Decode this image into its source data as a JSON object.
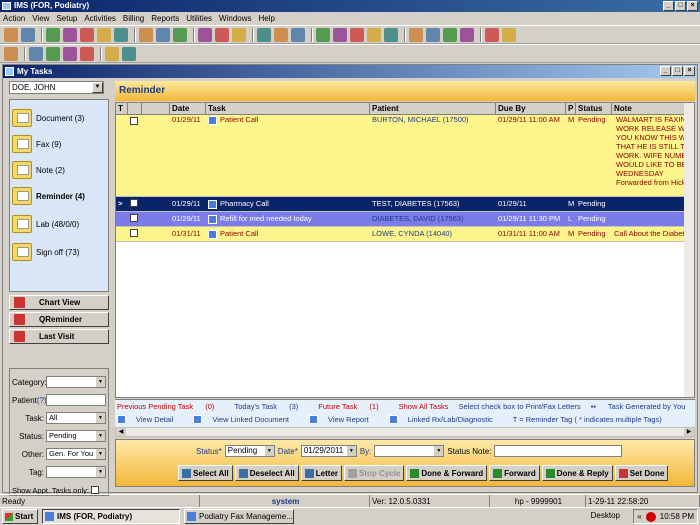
{
  "window": {
    "title": "IMS (FOR, Podiatry)",
    "controls": [
      "_",
      "□",
      "×"
    ]
  },
  "menu": [
    "Action",
    "View",
    "Setup",
    "Activities",
    "Billing",
    "Reports",
    "Utilities",
    "Windows",
    "Help"
  ],
  "toolbar_icons_row1": [
    "home-icon",
    "doctor-icon",
    "user-icon",
    "lab-icon",
    "document-icon",
    "chart-icon",
    "pdf-icon",
    "refresh-icon",
    "scan-icon",
    "calendar-icon",
    "sync-icon",
    "grid-icon",
    "tree-icon",
    "pen-icon",
    "mail-icon",
    "folder-icon",
    "export-icon",
    "import-icon",
    "person-icon",
    "gear-icon",
    "print-icon",
    "excel-icon",
    "word-icon",
    "note-icon",
    "help-icon",
    "lock-icon",
    "exit-icon"
  ],
  "toolbar_icons_row2": [
    "save-icon",
    "first-icon",
    "prev-icon",
    "next-icon",
    "last-icon",
    "reload-icon",
    "cancel-icon"
  ],
  "mdi": {
    "title": "My Tasks",
    "controls": [
      "_",
      "□",
      "×"
    ]
  },
  "patient_select": "DOE, JOHN",
  "categories": [
    {
      "label": "Document (3)"
    },
    {
      "label": "Fax (9)"
    },
    {
      "label": "Note (2)"
    },
    {
      "label": "Reminder (4)"
    },
    {
      "label": "Lab (48/0/0)"
    },
    {
      "label": "Sign off (73)"
    }
  ],
  "nav_buttons": [
    "Chart View",
    "QReminder",
    "Last Visit"
  ],
  "filters": {
    "category_label": "Category:",
    "category_value": "",
    "patient_label": "Patient",
    "patient_help": "(?)",
    "patient_value": "",
    "task_label": "Task:",
    "task_value": "All",
    "status_label": "Status:",
    "status_value": "Pending",
    "other_label": "Other:",
    "other_value": "Gen. For You",
    "tag_label": "Tag:",
    "tag_value": "",
    "show_appt_label": "Show Appt. Tasks only:"
  },
  "main_header": "Reminder",
  "grid": {
    "columns": [
      "T",
      "",
      "Date",
      "Task",
      "Patient",
      "Due By",
      "P",
      "Status",
      "Note"
    ],
    "rows": [
      {
        "marker": "",
        "date": "01/29/11",
        "task": "Patient Call",
        "patient": "BURTON, MICHAEL  (17500)",
        "due": "01/29/11  11:00 AM",
        "p": "M",
        "status": "Pending",
        "note": [
          "WALMART IS FAXING A",
          "WORK RELEASE WANT",
          "YOU KNOW THIS WIFE",
          "THAT HE IS STILL TO W",
          "WORK. WIFE NUMBER",
          "WOULD LIKE TO BE CP",
          "WEDNESDAY",
          "Forwarded from Hicks, Ja"
        ]
      },
      {
        "marker": ">",
        "date": "01/29/11",
        "task": "Pharmacy Call",
        "patient": "TEST, DIABETES  (17563)",
        "due": "01/29/11",
        "p": "M",
        "status": "Pending",
        "note": [
          ""
        ]
      },
      {
        "marker": "",
        "date": "01/29/11",
        "task": "Refill for med needed today",
        "patient": "DIABETES, DAVID  (17563)",
        "due": "01/29/11  11:30 PM",
        "p": "L",
        "status": "Pending",
        "note": [
          ""
        ]
      },
      {
        "marker": "",
        "date": "01/31/11",
        "task": "Patient Call",
        "patient": "LOWE, CYNDA  (14040)",
        "due": "01/31/11  11:00 AM",
        "p": "M",
        "status": "Pending",
        "note": [
          "Call About the Diabetic Fo"
        ]
      }
    ]
  },
  "legend": {
    "prev_pending": "Previous Pending Task",
    "prev_pending_count": "(0)",
    "today": "Today's Task",
    "today_count": "(3)",
    "future": "Future Task",
    "future_count": "(1)",
    "show_all": "Show All Tasks",
    "select_hint": "Select check box to Print/Fax Letters",
    "generated": "Task Generated by You",
    "view_detail": "View Detail",
    "view_linked": "View Linked Document",
    "view_report": "View Report",
    "linked_rx": "Linked Rx/Lab/Diagnostic",
    "tag_hint": "T = Reminder Tag ( * indicates multiple Tags)"
  },
  "bottom": {
    "status_label": "Status*",
    "status_value": "Pending",
    "date_label": "Date*",
    "date_value": "01/29/2011",
    "by_label": "By:",
    "by_value": "",
    "note_label": "Status Note:",
    "note_value": "",
    "buttons": [
      "Select All",
      "Deselect All",
      "Letter",
      "Stop Cycle",
      "Done & Forward",
      "Forward",
      "Done & Reply",
      "Set Done"
    ]
  },
  "statusbar": {
    "ready": "Ready",
    "user": "system",
    "version": "Ver: 12.0.5.0331",
    "hp": "hp - 9999901",
    "datetime": "1-29-11  22:58:20"
  },
  "taskbar": {
    "start": "Start",
    "tasks": [
      "IMS (FOR, Podiatry)",
      "Podiatry Fax Manageme..."
    ],
    "desktop": "Desktop",
    "clock": "10:58 PM"
  }
}
